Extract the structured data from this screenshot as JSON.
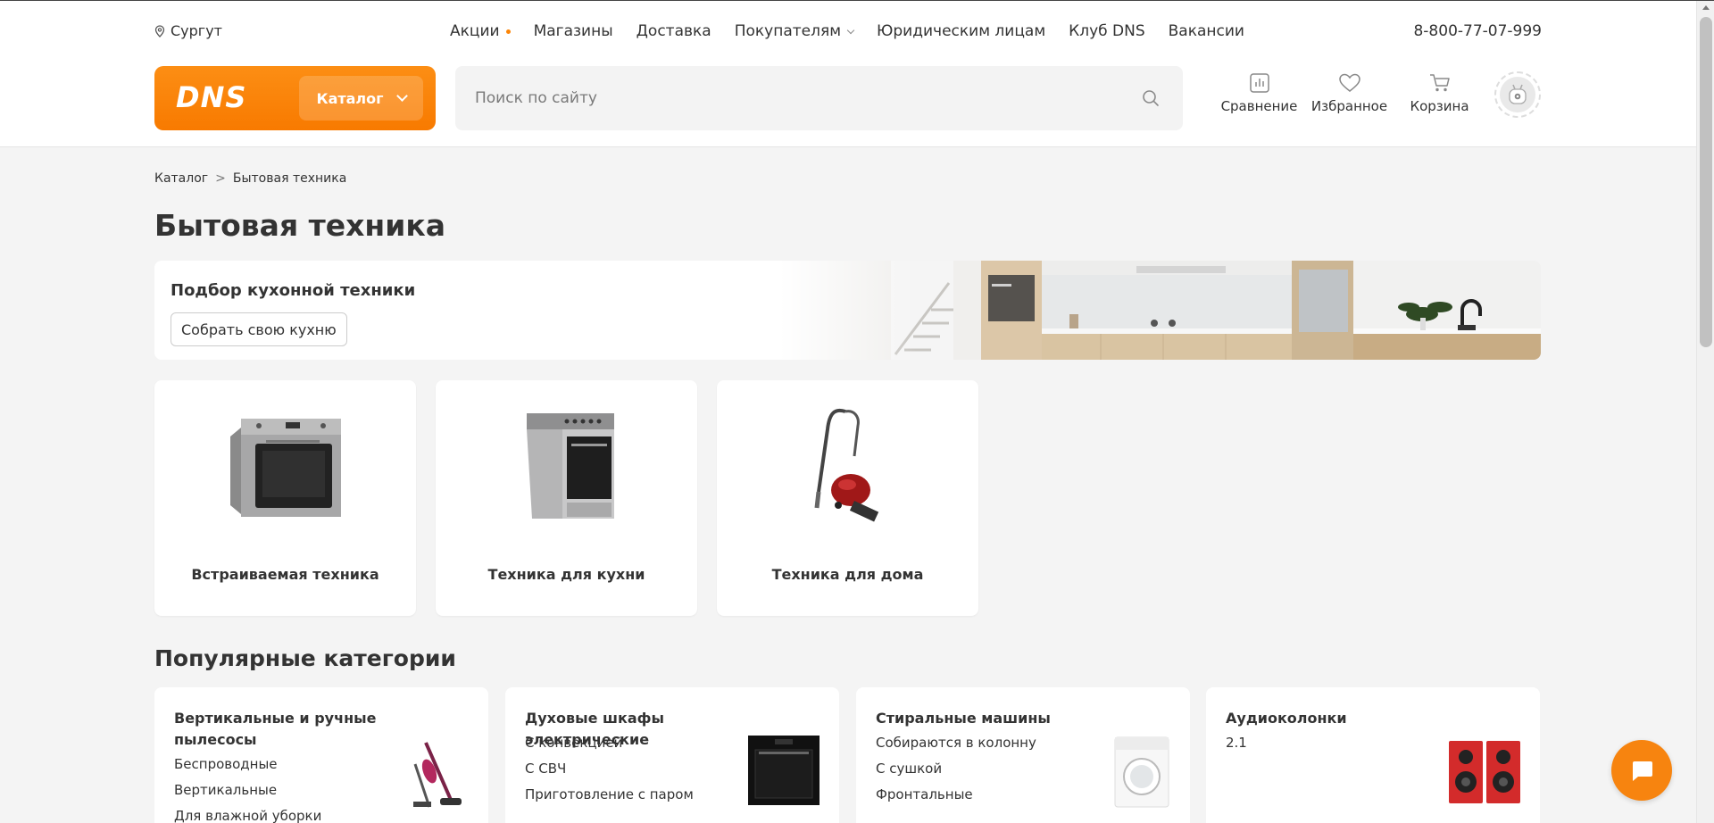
{
  "topbar": {
    "city": "Сургут",
    "nav": [
      "Акции",
      "Магазины",
      "Доставка",
      "Покупателям",
      "Юридическим лицам",
      "Клуб DNS",
      "Вакансии"
    ],
    "phone": "8-800-77-07-999"
  },
  "header": {
    "logo": "DNS",
    "catalog_label": "Каталог",
    "search_placeholder": "Поиск по сайту",
    "icons": [
      {
        "label": "Сравнение",
        "icon": "compare-icon"
      },
      {
        "label": "Избранное",
        "icon": "heart-icon"
      },
      {
        "label": "Корзина",
        "icon": "cart-icon"
      }
    ]
  },
  "breadcrumb": {
    "root": "Каталог",
    "separator": ">",
    "current": "Бытовая техника"
  },
  "page_title": "Бытовая техника",
  "promo": {
    "title": "Подбор кухонной техники",
    "button": "Собрать свою кухню"
  },
  "categories": [
    {
      "label": "Встраиваемая техника",
      "icon": "oven-icon"
    },
    {
      "label": "Техника для кухни",
      "icon": "stove-icon"
    },
    {
      "label": "Техника для дома",
      "icon": "vacuum-icon"
    }
  ],
  "popular": {
    "title": "Популярные категории",
    "cards": [
      {
        "title": "Вертикальные и ручные пылесосы",
        "links": [
          "Беспроводные",
          "Вертикальные",
          "Для влажной уборки"
        ]
      },
      {
        "title": "Духовые шкафы электрические",
        "links": [
          "С конвекцией",
          "С СВЧ",
          "Приготовление с паром"
        ]
      },
      {
        "title": "Стиральные машины",
        "links": [
          "Собираются в колонну",
          "С сушкой",
          "Фронтальные"
        ]
      },
      {
        "title": "Аудиоколонки",
        "links": [
          "2.1"
        ]
      }
    ]
  },
  "colors": {
    "brand": "#fc8507",
    "background": "#f4f4f4"
  }
}
